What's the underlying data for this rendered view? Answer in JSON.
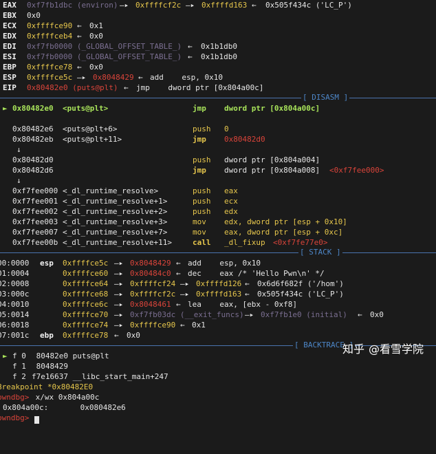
{
  "registers": [
    {
      "name": "EAX",
      "value": "0xf7fb1dbc (environ)",
      "chain": [
        "0xffffcf2c",
        "0xffffd163",
        "0x505f434c ('LC_P')"
      ]
    },
    {
      "name": "EBX",
      "value": "0x0"
    },
    {
      "name": "ECX",
      "value": "0xffffce90",
      "chain": [
        "0x1"
      ]
    },
    {
      "name": "EDX",
      "value": "0xffffceb4",
      "chain": [
        "0x0"
      ]
    },
    {
      "name": "EDI",
      "value": "0xf7fb0000 (_GLOBAL_OFFSET_TABLE_)",
      "chain": [
        "0x1b1db0"
      ]
    },
    {
      "name": "ESI",
      "value": "0xf7fb0000 (_GLOBAL_OFFSET_TABLE_)",
      "chain": [
        "0x1b1db0"
      ]
    },
    {
      "name": "EBP",
      "value": "0xffffce78",
      "chain": [
        "0x0"
      ]
    },
    {
      "name": "ESP",
      "value": "0xffffce5c",
      "chain": [
        "0x8048429",
        "add    esp, 0x10"
      ]
    },
    {
      "name": "EIP",
      "value": "0x80482e0 (puts@plt)",
      "chain": [
        "jmp    dword ptr [0x804a00c]"
      ]
    }
  ],
  "sections": {
    "disasm": "DISASM",
    "stack": "STACK",
    "backtrace": "BACKTRACE"
  },
  "disasm": [
    {
      "arrow": "►",
      "addr": "0x80482e0",
      "sym": "<puts@plt>",
      "mn": "jmp",
      "ops": "dword ptr [0x804a00c]",
      "current": true
    },
    {
      "addr": "0x80482e6",
      "sym": "<puts@plt+6>",
      "mn": "push",
      "ops": "0"
    },
    {
      "addr": "0x80482eb",
      "sym": "<puts@plt+11>",
      "mn": "jmp",
      "ops": "0x80482d0"
    },
    {
      "down": "↓"
    },
    {
      "addr": "0x80482d0",
      "sym": "",
      "mn": "push",
      "ops": "dword ptr [0x804a004]"
    },
    {
      "addr": "0x80482d6",
      "sym": "",
      "mn": "jmp",
      "ops": "dword ptr [0x804a008]",
      "tail": "<0xf7fee000>"
    },
    {
      "down": "↓"
    },
    {
      "addr": "0xf7fee000",
      "sym": "<_dl_runtime_resolve>",
      "mn": "push",
      "ops": "eax"
    },
    {
      "addr": "0xf7fee001",
      "sym": "<_dl_runtime_resolve+1>",
      "mn": "push",
      "ops": "ecx"
    },
    {
      "addr": "0xf7fee002",
      "sym": "<_dl_runtime_resolve+2>",
      "mn": "push",
      "ops": "edx"
    },
    {
      "addr": "0xf7fee003",
      "sym": "<_dl_runtime_resolve+3>",
      "mn": "mov",
      "ops": "edx, dword ptr [esp + 0x10]"
    },
    {
      "addr": "0xf7fee007",
      "sym": "<_dl_runtime_resolve+7>",
      "mn": "mov",
      "ops": "eax, dword ptr [esp + 0xc]"
    },
    {
      "addr": "0xf7fee00b",
      "sym": "<_dl_runtime_resolve+11>",
      "mn": "call",
      "ops": "_dl_fixup",
      "tail": "<0xf7fe77e0>"
    }
  ],
  "stack": [
    {
      "off": "00:0000",
      "reg": "esp",
      "addr": "0xffffce5c",
      "chain": [
        "0x8048429",
        "add    esp, 0x10"
      ]
    },
    {
      "off": "01:0004",
      "reg": "",
      "addr": "0xffffce60",
      "chain": [
        "0x80484c0",
        "dec    eax /* 'Hello Pwn\\n' */"
      ]
    },
    {
      "off": "02:0008",
      "reg": "",
      "addr": "0xffffce64",
      "chain": [
        "0xffffcf24",
        "0xffffd126",
        "0x6d6f682f ('/hom')"
      ]
    },
    {
      "off": "03:000c",
      "reg": "",
      "addr": "0xffffce68",
      "chain": [
        "0xffffcf2c",
        "0xffffd163",
        "0x505f434c ('LC_P')"
      ]
    },
    {
      "off": "04:0010",
      "reg": "",
      "addr": "0xffffce6c",
      "chain": [
        "0x8048461",
        "lea    eax, [ebx - 0xf8]"
      ]
    },
    {
      "off": "05:0014",
      "reg": "",
      "addr": "0xffffce70",
      "chain": [
        "0xf7fb03dc (__exit_funcs)",
        "0xf7fb1e0 (initial)",
        "0x0"
      ]
    },
    {
      "off": "06:0018",
      "reg": "",
      "addr": "0xffffce74",
      "chain": [
        "0xffffce90",
        "0x1"
      ]
    },
    {
      "off": "07:001c",
      "reg": "ebp",
      "addr": "0xffffce78",
      "chain": [
        "0x0"
      ]
    }
  ],
  "backtrace": [
    {
      "arrow": "►",
      "frame": "f 0",
      "text": " 80482e0 puts@plt"
    },
    {
      "arrow": "",
      "frame": "f 1",
      "text": " 8048429"
    },
    {
      "arrow": "",
      "frame": "f 2",
      "text": "f7e16637 __libc_start_main+247"
    }
  ],
  "console": [
    {
      "kind": "bp",
      "text": "Breakpoint *0x80482E0"
    },
    {
      "kind": "cmd",
      "prompt": "pwndbg>",
      "text": " x/wx 0x804a00c"
    },
    {
      "kind": "out",
      "text": "0x804a00c:       0x080482e6"
    },
    {
      "kind": "prompt",
      "prompt": "pwndbg>",
      "text": " "
    }
  ],
  "watermark": {
    "site": "知乎",
    "at": "@看雪学院"
  },
  "colors": {
    "background": "#1b1b1b",
    "register": "#f2f2f2",
    "stack_addr": "#e6c64c",
    "code_addr": "#d9443a",
    "mapped": "#7a6e90",
    "mnemonic": "#e6c64c",
    "separator": "#4d86c7",
    "current": "#a8e35a"
  }
}
